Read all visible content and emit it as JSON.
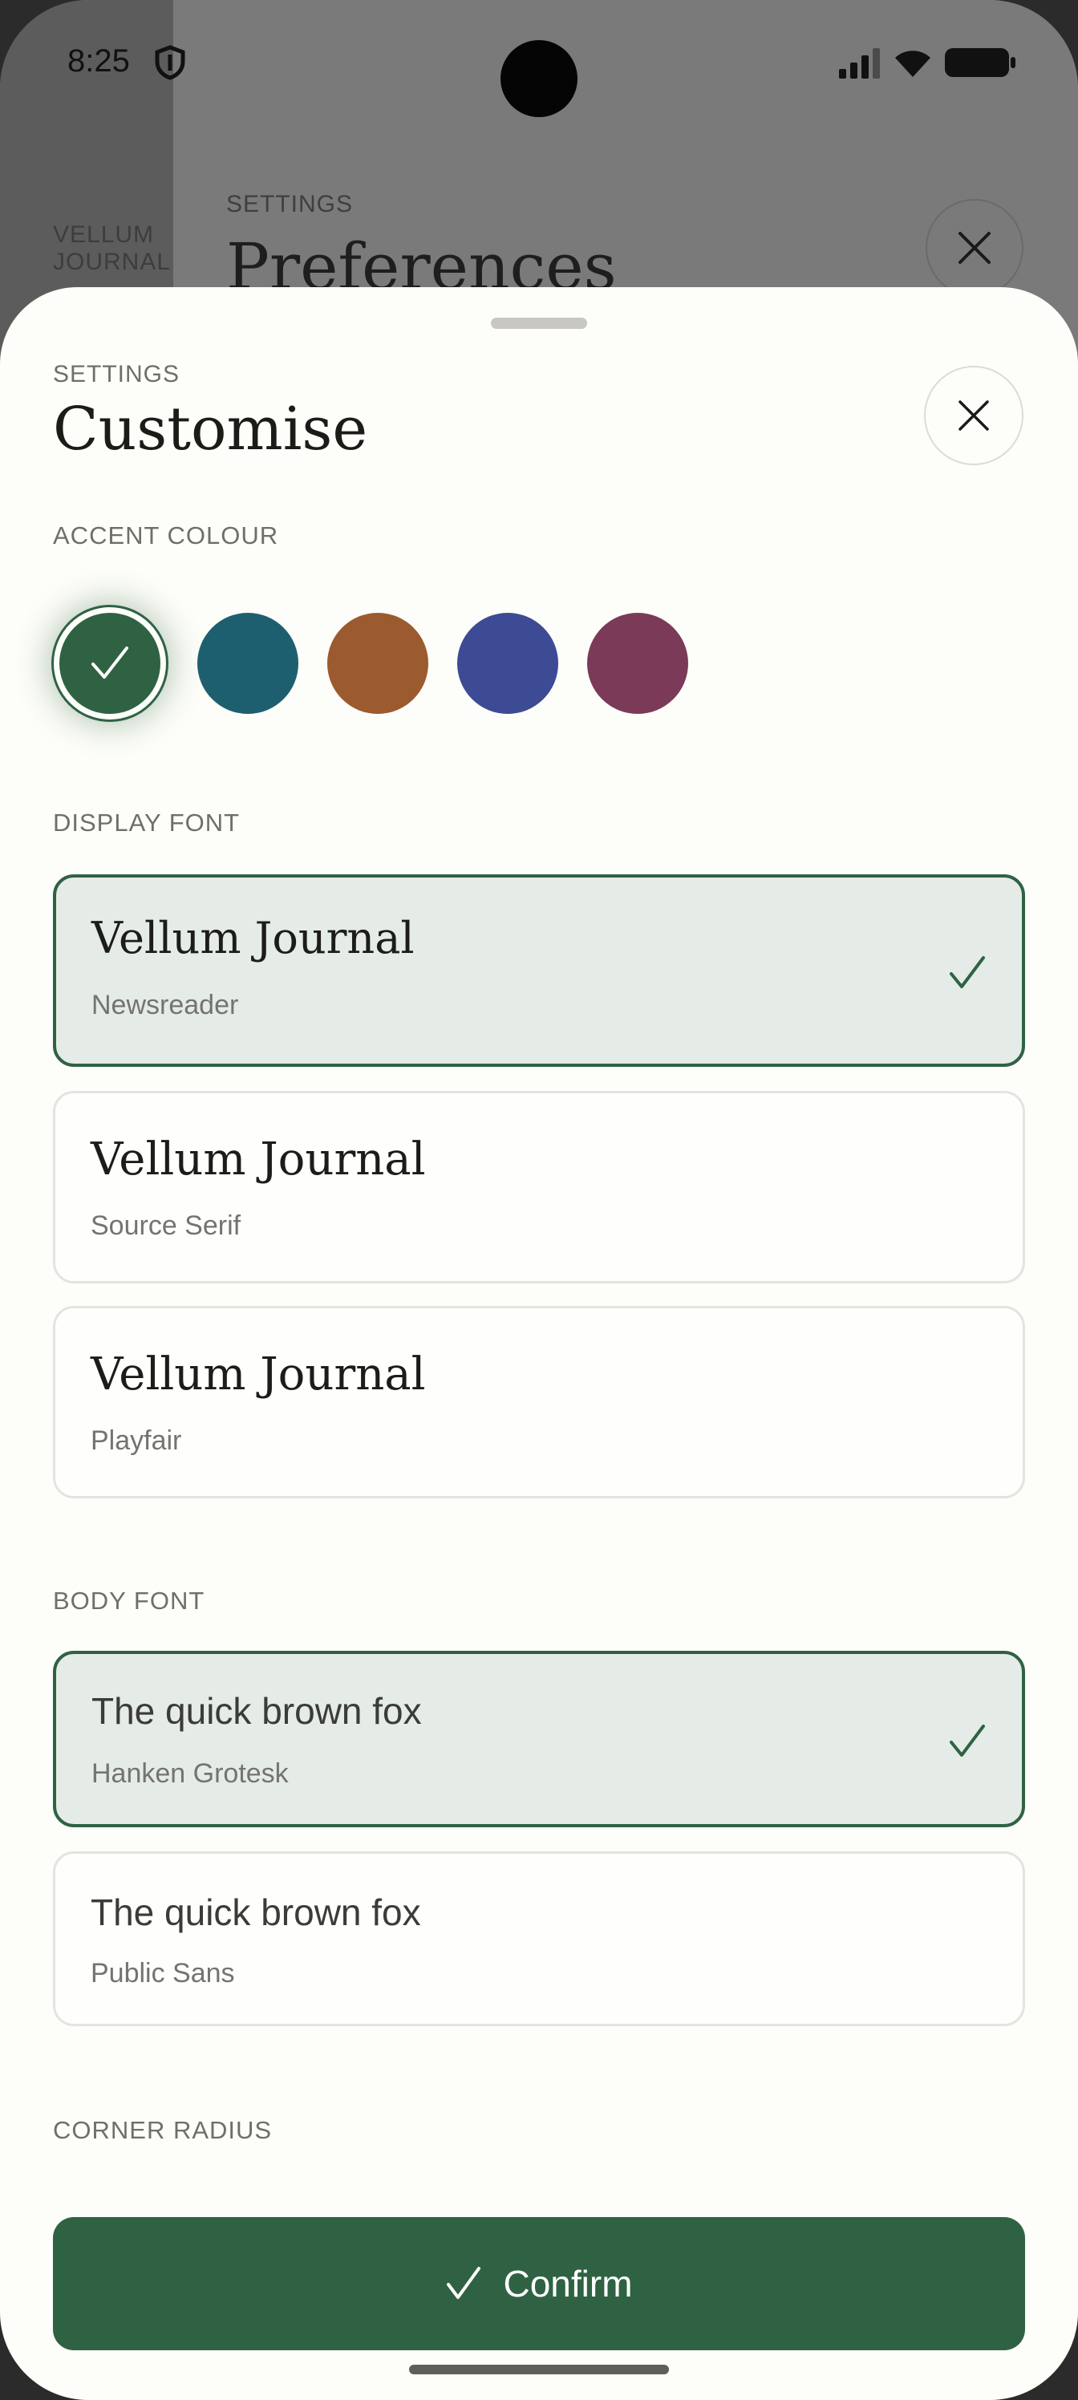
{
  "status_bar": {
    "time": "8:25"
  },
  "background": {
    "side_label": "VELLUM JOURNAL",
    "label": "SETTINGS",
    "title": "Preferences"
  },
  "sheet": {
    "label": "SETTINGS",
    "title": "Customise"
  },
  "accent": {
    "section": "ACCENT COLOUR",
    "colors": [
      "#2f6243",
      "#1e5f6f",
      "#9b5b2e",
      "#3d4b95",
      "#7a3a58"
    ],
    "selected_index": 0
  },
  "display_font": {
    "section": "DISPLAY FONT",
    "options": [
      {
        "sample": "Vellum Journal",
        "name": "Newsreader",
        "selected": true
      },
      {
        "sample": "Vellum Journal",
        "name": "Source Serif",
        "selected": false
      },
      {
        "sample": "Vellum Journal",
        "name": "Playfair",
        "selected": false
      }
    ]
  },
  "body_font": {
    "section": "BODY FONT",
    "options": [
      {
        "sample": "The quick brown fox",
        "name": "Hanken Grotesk",
        "selected": true
      },
      {
        "sample": "The quick brown fox",
        "name": "Public Sans",
        "selected": false
      }
    ]
  },
  "corner_radius": {
    "section": "CORNER RADIUS"
  },
  "confirm": {
    "label": "Confirm"
  },
  "colors": {
    "accent": "#2f6243",
    "sheet_bg": "#fdfdf9"
  }
}
